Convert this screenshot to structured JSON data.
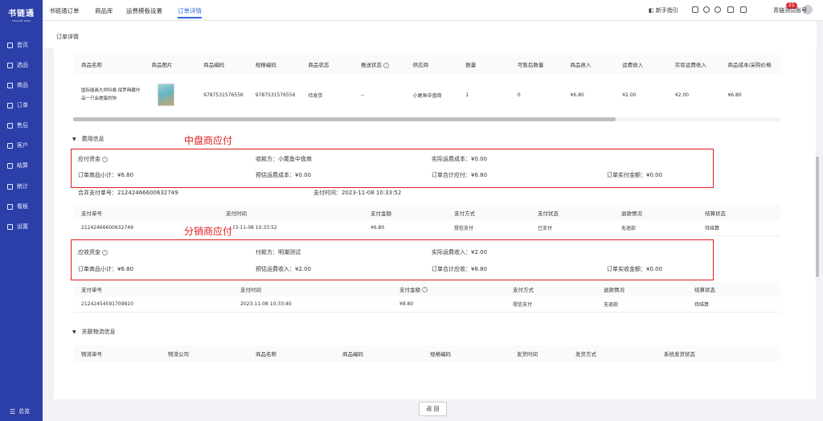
{
  "sidebar": {
    "logo": "书链通",
    "logo_sub": "SHULIAN TONG",
    "items": [
      {
        "label": "首页"
      },
      {
        "label": "选品"
      },
      {
        "label": "商品"
      },
      {
        "label": "订单"
      },
      {
        "label": "售后"
      },
      {
        "label": "客户"
      },
      {
        "label": "结算"
      },
      {
        "label": "统计"
      },
      {
        "label": "看板"
      },
      {
        "label": "设置"
      }
    ],
    "collapse_label": "总览"
  },
  "topbar": {
    "tabs": [
      {
        "label": "书链通订单"
      },
      {
        "label": "商品库"
      },
      {
        "label": "运费模板设置"
      },
      {
        "label": "订单详情"
      }
    ],
    "guide": "新手指引",
    "badge": "21",
    "account": "青链测试账号"
  },
  "breadcrumb": "订单详情",
  "goods_table": {
    "headers": [
      "商品名称",
      "商品图片",
      "商品编码",
      "规格编码",
      "商品状态",
      "推送状态",
      "供应商",
      "数量",
      "可售后数量",
      "商品收入",
      "运费收入",
      "实际运费收入",
      "商品成本/采购价格"
    ],
    "row": {
      "name": "国际插画大师科桑·保罗典藏作品一只会搓蛋的狗",
      "code": "9787531576556",
      "spec": "9787531576556",
      "status": "待发货",
      "push": "--",
      "supplier": "小尾鱼中盘商",
      "qty": "1",
      "after_qty": "0",
      "income": "¥6.80",
      "freight": "¥2.00",
      "real_freight": "¥2.00",
      "cost": "¥6.80"
    }
  },
  "fee_section": {
    "title": "费用信息"
  },
  "payable": {
    "annotation": "中盘商应付",
    "title": "应付资金",
    "receiver": "收款方：小尾鱼中盘商",
    "real_freight_cost": "实际运费成本：¥0.00",
    "goods_subtotal": "订单商品小计：¥6.80",
    "est_freight_cost": "预估运费成本：¥0.00",
    "order_total": "订单合计应付：¥6.80",
    "paid_amount": "订单实付金额：¥0.00"
  },
  "merge_pay": {
    "no": "合并支付单号：21242466600632749",
    "time": "支付时间：2023-11-08 10:33:52"
  },
  "pay_table": {
    "headers": [
      "支付单号",
      "支付时间",
      "支付金额",
      "支付方式",
      "支付状态",
      "退款情况",
      "结算状态"
    ],
    "row": [
      "21242466600632749",
      "2023-11-08 10:33:52",
      "¥6.80",
      "授信支付",
      "已支付",
      "无退款",
      "待结算"
    ]
  },
  "receivable": {
    "annotation": "分销商应付",
    "title": "应收资金",
    "payer": "付款方：明潮测试",
    "real_freight_income": "实际运费收入：¥2.00",
    "goods_subtotal": "订单商品小计：¥6.80",
    "est_freight_income": "预估运费收入：¥2.00",
    "order_total": "订单合计应收：¥8.80",
    "received_amount": "订单实收金额：¥0.00"
  },
  "collect_table": {
    "headers": [
      "支付单号",
      "支付时间",
      "支付金额",
      "支付方式",
      "退款情况",
      "结算状态"
    ],
    "row": [
      "21242454591709810",
      "2023-11-08 10:33:40",
      "¥8.80",
      "授信支付",
      "无退款",
      "待结算"
    ]
  },
  "logistics": {
    "title": "关联物流信息",
    "headers": [
      "物流单号",
      "物流公司",
      "商品名称",
      "商品编码",
      "规格编码",
      "发货时间",
      "发货方式",
      "系统发货状态"
    ]
  },
  "back_label": "返 回"
}
